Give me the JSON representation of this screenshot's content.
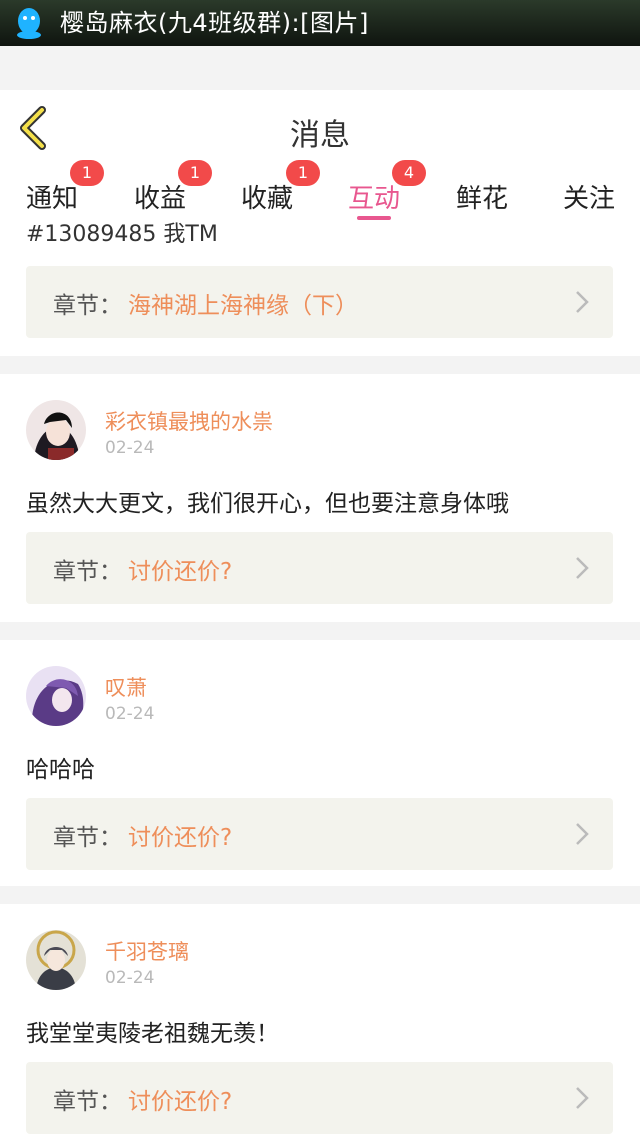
{
  "statusbar": {
    "title": "樱岛麻衣(九4班级群):[图片]"
  },
  "header": {
    "title": "消息"
  },
  "tabs": [
    {
      "label": "通知",
      "badge": "1"
    },
    {
      "label": "收益",
      "badge": "1"
    },
    {
      "label": "收藏",
      "badge": "1"
    },
    {
      "label": "互动",
      "badge": "4",
      "active": true
    },
    {
      "label": "鲜花"
    },
    {
      "label": "关注"
    }
  ],
  "partial": {
    "text": "#13089485 我TM",
    "chapter_label": "章节：",
    "chapter_value": "海神湖上海神缘（下）"
  },
  "items": [
    {
      "username": "彩衣镇最拽的水祟",
      "date": "02-24",
      "comment": "虽然大大更文，我们很开心，但也要注意身体哦",
      "chapter_label": "章节：",
      "chapter_value": "讨价还价?"
    },
    {
      "username": "叹萧",
      "date": "02-24",
      "comment": "哈哈哈",
      "chapter_label": "章节：",
      "chapter_value": "讨价还价?"
    },
    {
      "username": "千羽苍璃",
      "date": "02-24",
      "comment": "我堂堂夷陵老祖魏无羡！",
      "chapter_label": "章节：",
      "chapter_value": "讨价还价?"
    }
  ],
  "colors": {
    "accent": "#e8578f",
    "username": "#ee8e5a",
    "badge": "#f24a4a"
  }
}
